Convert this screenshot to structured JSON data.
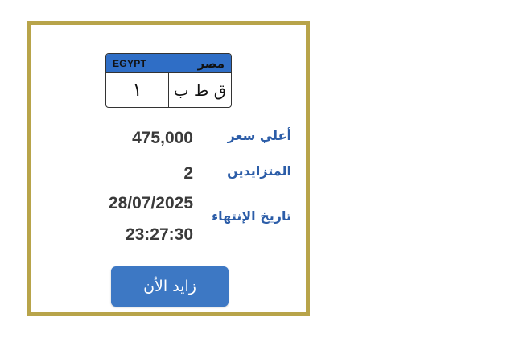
{
  "plate": {
    "country_en": "EGYPT",
    "country_ar": "مصر",
    "number": "١",
    "letters": "ق ط ب",
    "header_color": "#2f6ec6"
  },
  "auction": {
    "highest_price_label": "أعلي سعر",
    "highest_price_value": "475,000",
    "bidders_label": "المتزايدين",
    "bidders_value": "2",
    "end_date_label": "تاريخ الإنتهاء",
    "end_date_value": "28/07/2025",
    "end_time_value": "23:27:30"
  },
  "button": {
    "bid_label": "زايد الأن",
    "color": "#3d78c4"
  },
  "frame_color": "#b8a44a"
}
